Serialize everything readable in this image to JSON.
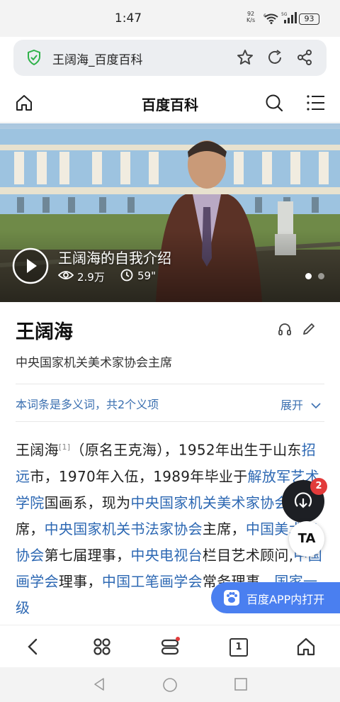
{
  "status_bar": {
    "time": "1:47",
    "net_speed_value": "92",
    "net_speed_unit": "K/s",
    "wifi_label": "6",
    "cell_label": "5G",
    "battery": "93"
  },
  "address_bar": {
    "title": "王阔海_百度百科",
    "icons": [
      "shield-check-icon",
      "star-icon",
      "refresh-icon",
      "share-icon"
    ]
  },
  "site_header": {
    "brand": "百度百科",
    "icons": [
      "home-icon",
      "search-icon",
      "menu-icon"
    ]
  },
  "hero": {
    "caption": "王阔海的自我介绍",
    "views": "2.9万",
    "duration": "59\"",
    "slide_count": 2,
    "active_slide": 1
  },
  "article": {
    "title": "王阔海",
    "subtitle": "中央国家机关美术家协会主席",
    "polysemy_note": "本词条是多义词，共2个义项",
    "expand_label": "展开",
    "action_icons": [
      "headphones-icon",
      "edit-pencil-icon"
    ],
    "body_segments": [
      {
        "text": "王阔海",
        "link": false
      },
      {
        "text": "[1]",
        "ref": true
      },
      {
        "text": "（原名王克海），1952年出生于山东",
        "link": false
      },
      {
        "text": "招远",
        "link": true
      },
      {
        "text": "市，1970年入伍，1989年毕业于",
        "link": false
      },
      {
        "text": "解放军艺术学院",
        "link": true
      },
      {
        "text": "国画系，现为",
        "link": false
      },
      {
        "text": "中央国家机关美术家协会",
        "link": true
      },
      {
        "text": "主席，",
        "link": false
      },
      {
        "text": "中央国家机关书法家协会",
        "link": true
      },
      {
        "text": "主席，",
        "link": false
      },
      {
        "text": "中国美术家协会",
        "link": true
      },
      {
        "text": "第七届理事，",
        "link": false
      },
      {
        "text": "中央电视台",
        "link": true
      },
      {
        "text": "栏目艺术顾问,",
        "link": false
      },
      {
        "text": "中国画学会",
        "link": true
      },
      {
        "text": "理事，",
        "link": false
      },
      {
        "text": "中国工笔画学会",
        "link": true
      },
      {
        "text": "常务理事，",
        "link": false
      },
      {
        "text": "国家一级",
        "link": true
      }
    ]
  },
  "floating": {
    "badge_count": "2",
    "ta_label": "TA",
    "open_app_label": "百度APP内打开"
  },
  "bottom_nav": {
    "icons": [
      "back-arrow-icon",
      "apps-icon",
      "stack-icon",
      "tab-count-icon",
      "home-icon"
    ],
    "tab_count": "1"
  },
  "system_nav": {
    "icons": [
      "back-triangle-icon",
      "home-circle-icon",
      "recents-square-icon"
    ]
  },
  "colors": {
    "link": "#2d68b3",
    "accent_blue": "#4a7ff0",
    "badge_red": "#e23b3b",
    "secure_green": "#2fb24a"
  }
}
